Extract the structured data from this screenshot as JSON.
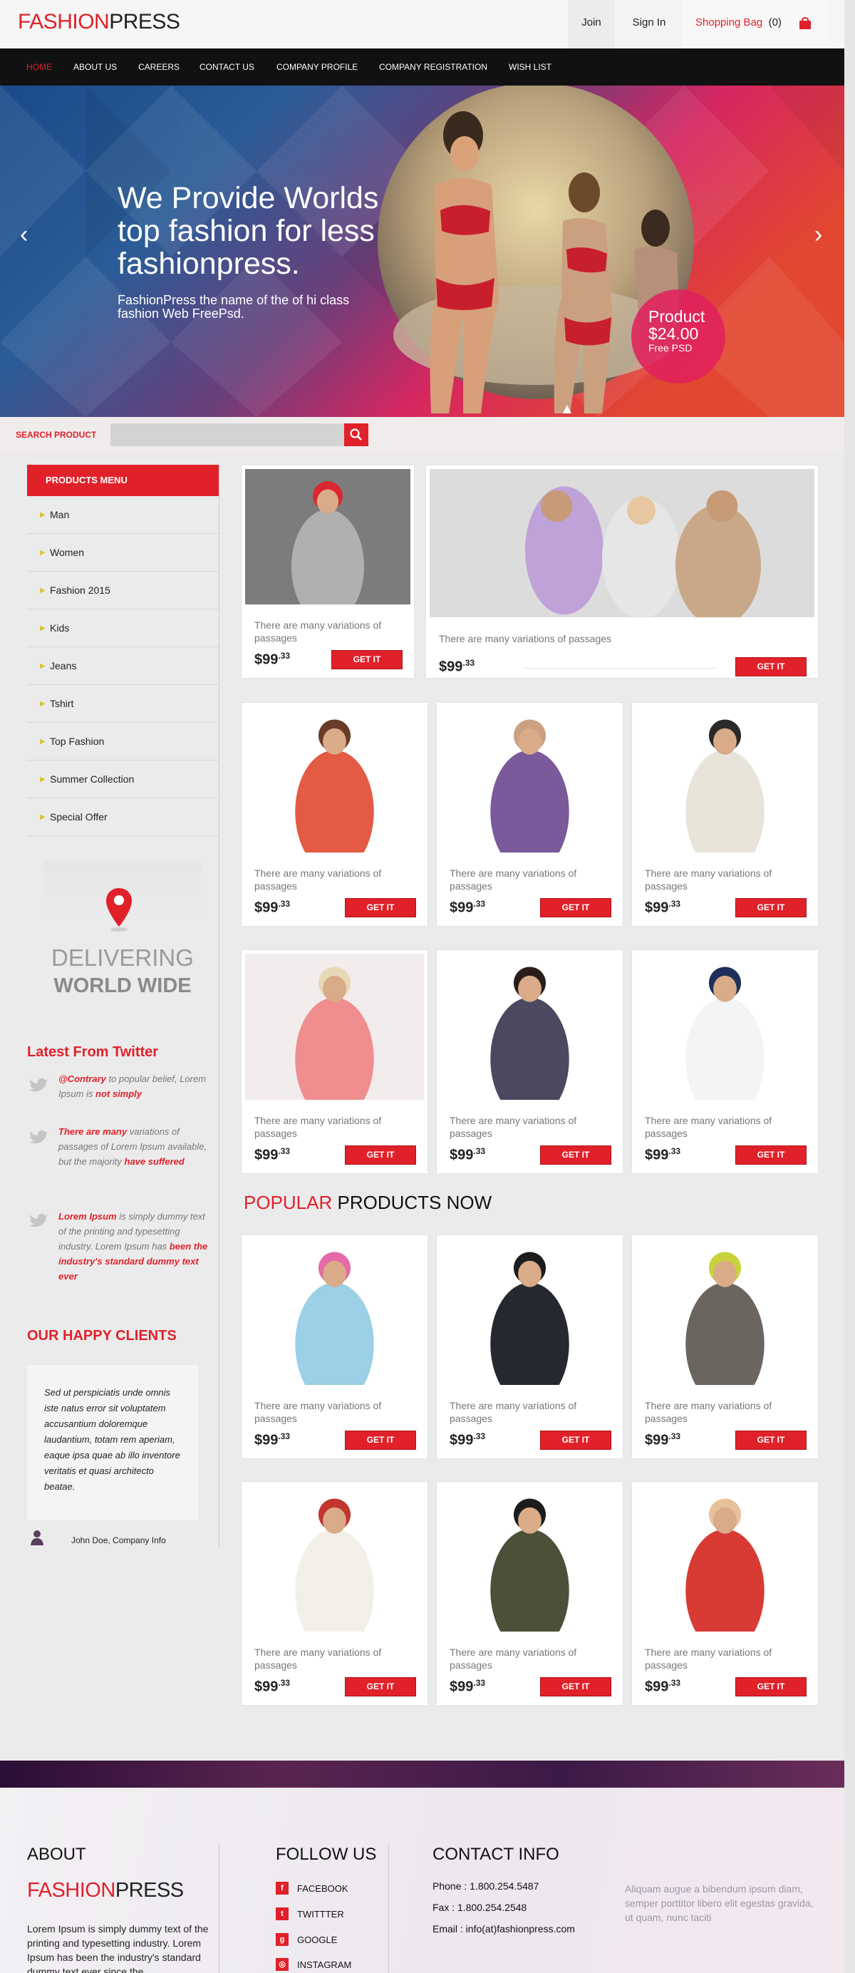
{
  "header": {
    "logo": {
      "part1": "FASHION",
      "part2": "PRESS"
    },
    "join": "Join",
    "signin": "Sign In",
    "bag_label": "Shopping Bag",
    "bag_count": "(0)"
  },
  "nav": [
    "HOME",
    "ABOUT US",
    "CAREERS",
    "CONTACT US",
    "COMPANY PROFILE",
    "COMPANY REGISTRATION",
    "WISH LIST"
  ],
  "hero": {
    "line1": "We Provide Worlds",
    "line2": "top fashion for less",
    "line3": "fashionpress.",
    "sub1": "FashionPress the name of the of hi class",
    "sub2": "fashion Web FreePsd.",
    "badge_label": "Product",
    "badge_price": "$24.00",
    "badge_sub": "Free PSD",
    "prev": "‹",
    "next": "›"
  },
  "search": {
    "label": "SEARCH PRODUCT",
    "placeholder": ""
  },
  "products_menu": {
    "title": "PRODUCTS MENU",
    "items": [
      "Man",
      "Women",
      "Fashion 2015",
      "Kids",
      "Jeans",
      "Tshirt",
      "Top Fashion",
      "Summer Collection",
      "Special Offer"
    ]
  },
  "delivering": {
    "line1": "DELIVERING",
    "line2": "WORLD WIDE"
  },
  "twitter": {
    "title": "Latest From Twitter",
    "t1": {
      "a": "@Contrary",
      "b": " to popular belief, Lorem Ipsum is ",
      "c": "not simply"
    },
    "t2": {
      "a": "There are many",
      "b": " variations of passages of Lorem Ipsum available, but the majority ",
      "c": "have suffered"
    },
    "t3": {
      "a": "Lorem Ipsum",
      "b": " is simply dummy text of the printing and typesetting industry. Lorem Ipsum has ",
      "c": "been the industry's standard dummy text ever"
    }
  },
  "clients": {
    "title": "OUR HAPPY CLIENTS",
    "quote": "Sed ut perspiciatis unde omnis iste natus error sit voluptatem accusantium doloremque laudantium, totam rem aperiam, eaque ipsa quae ab illo inventore veritatis et quasi architecto beatae.",
    "author": "John Doe, Company Info"
  },
  "product": {
    "desc": "There are many variations of passages",
    "price_main": "$99",
    "price_cents": ".33",
    "button": "GET IT"
  },
  "popular": {
    "a": "POPULAR",
    "b": " PRODUCTS NOW"
  },
  "footer": {
    "about_title": "ABOUT",
    "about_text": "Lorem Ipsum is simply dummy text of the printing and typesetting industry. Lorem Ipsum has been the industry's standard dummy text ever since the",
    "follow_title": "FOLLOW US",
    "social": [
      "FACEBOOK",
      "TWITTTER",
      "GOOGLE",
      "INSTAGRAM"
    ],
    "contact_title": "CONTACT INFO",
    "phone": "Phone : 1.800.254.5487",
    "fax": "Fax : 1.800.254.2548",
    "email": "Email : info(at)fashionpress.com",
    "lorem": "Aliquam augue a bibendum ipsum diam, semper porttitor libero elit egestas gravida, ut quam, nunc taciti"
  },
  "colors": {
    "accent": "#e0212a",
    "nav_bg": "#111111"
  }
}
